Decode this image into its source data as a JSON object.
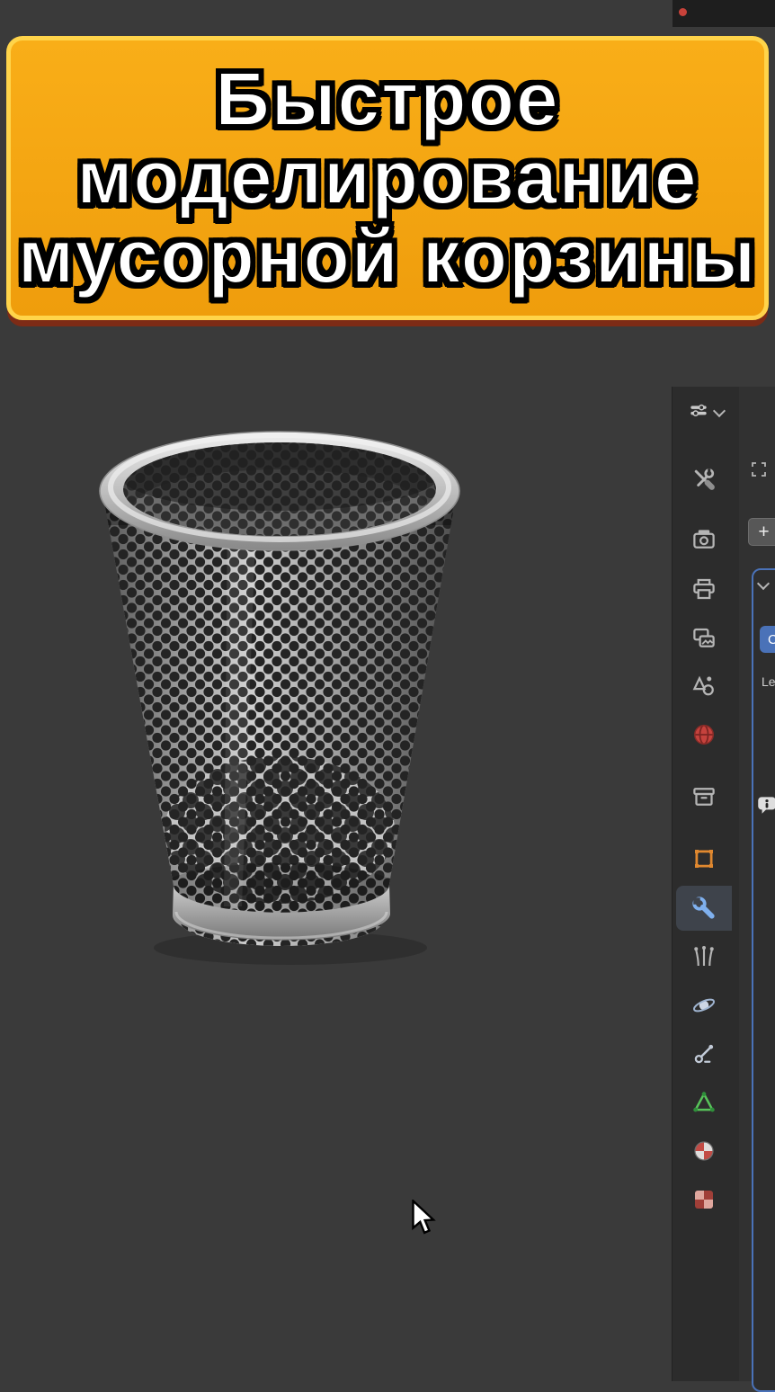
{
  "banner": {
    "lines": [
      "Быстрое",
      "моделирование",
      "мусорной корзины"
    ],
    "fill_color": "#f5a312",
    "border_color": "#ffd44a",
    "shadow_color": "#7d2b16"
  },
  "viewport": {
    "background_color": "#3a3a3a",
    "model": "perforated-metal-trash-can",
    "cursor": "arrow-cursor-icon"
  },
  "properties_panel": {
    "editor_type": {
      "icon": "properties-editor-icon",
      "chevron": "chevron-down-icon"
    },
    "tabs": [
      {
        "id": "tool",
        "icon": "tool-icon",
        "active": false
      },
      {
        "id": "render",
        "icon": "render-icon",
        "active": false
      },
      {
        "id": "output",
        "icon": "output-printer-icon",
        "active": false
      },
      {
        "id": "view-layer",
        "icon": "view-layer-icon",
        "active": false
      },
      {
        "id": "scene",
        "icon": "scene-icon",
        "active": false
      },
      {
        "id": "world",
        "icon": "world-globe-icon",
        "active": false
      },
      {
        "id": "collection",
        "icon": "collection-box-icon",
        "active": false
      },
      {
        "id": "object",
        "icon": "object-square-icon",
        "active": false
      },
      {
        "id": "modifiers",
        "icon": "wrench-icon",
        "active": true
      },
      {
        "id": "particles",
        "icon": "particles-icon",
        "active": false
      },
      {
        "id": "physics",
        "icon": "physics-orbit-icon",
        "active": false
      },
      {
        "id": "constraints",
        "icon": "constraint-icon",
        "active": false
      },
      {
        "id": "object-data",
        "icon": "mesh-data-icon",
        "active": false
      },
      {
        "id": "material",
        "icon": "material-sphere-icon",
        "active": false
      },
      {
        "id": "texture",
        "icon": "texture-checker-icon",
        "active": false
      }
    ],
    "content": {
      "maximize_icon": "corner-brackets-icon",
      "plus_label": "+",
      "collapse_chevron": "chevron-down-icon",
      "catmull_partial": "C",
      "levels_partial": "Le",
      "info_icon": "info-bubble-icon"
    },
    "colors": {
      "accent_blue": "#4a72b8",
      "active_icon_blue": "#7fb0ee",
      "world_red": "#c5423d",
      "object_orange": "#e0882f",
      "data_green": "#57c35a",
      "material_red": "#c24b45"
    }
  }
}
